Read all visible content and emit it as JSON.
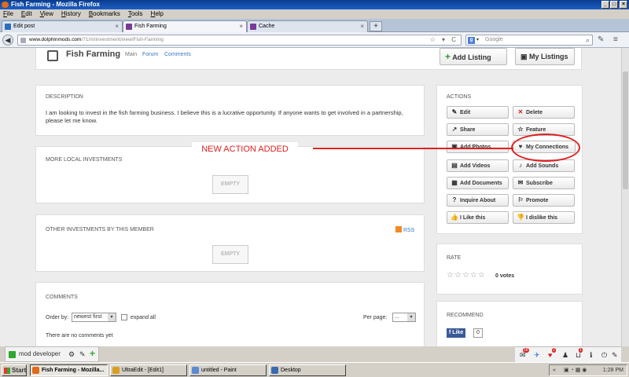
{
  "window": {
    "title": "Fish Farming - Mozilla Firefox",
    "minimize": "_",
    "maximize": "□",
    "close": "×"
  },
  "menu": [
    "File",
    "Edit",
    "View",
    "History",
    "Bookmarks",
    "Tools",
    "Help"
  ],
  "tabs": [
    {
      "label": "Edit post",
      "close": "×"
    },
    {
      "label": "Fish Farming",
      "close": "×"
    },
    {
      "label": "Cache",
      "close": "×"
    }
  ],
  "new_tab": "+",
  "nav": {
    "back": "◀",
    "url_domain": "www.dolphinmods.com",
    "url_path": "/71/m/investment/view/Fish-Farming",
    "url_controls": "☆ ▾ C",
    "search_engine_label": "g",
    "search_placeholder": "Google",
    "search_icon": "⌕",
    "wrench": "✎",
    "menu_icon": "≡"
  },
  "page": {
    "title": "Fish Farming",
    "subnav": [
      "Main",
      "Forum",
      "Comments"
    ],
    "add_listing": "Add Listing",
    "my_listings": "My Listings",
    "description": {
      "heading": "DESCRIPTION",
      "text": "I am looking to invest in the fish farming business. I believe this is a lucrative opportunity. If anyone wants to get involved in a partnership, please let me know."
    },
    "more_local": {
      "heading": "MORE LOCAL INVESTMENTS",
      "empty": "EMPTY"
    },
    "other_by_member": {
      "heading": "OTHER INVESTMENTS BY THIS MEMBER",
      "rss": "RSS",
      "empty": "EMPTY"
    },
    "comments": {
      "heading": "COMMENTS",
      "order_label": "Order by:",
      "order_value": "newest first",
      "expand_all": "expand all",
      "per_page_label": "Per page:",
      "per_page_value": "...",
      "none": "There are no comments yet"
    },
    "actions": {
      "heading": "ACTIONS",
      "buttons": [
        {
          "label": "Edit",
          "icon": "✎"
        },
        {
          "label": "Delete",
          "icon": "✕"
        },
        {
          "label": "Share",
          "icon": "↗"
        },
        {
          "label": "Feature",
          "icon": "☆"
        },
        {
          "label": "Add Photos",
          "icon": "▣"
        },
        {
          "label": "My Connections",
          "icon": "♥"
        },
        {
          "label": "Add Videos",
          "icon": "▤"
        },
        {
          "label": "Add Sounds",
          "icon": "♪"
        },
        {
          "label": "Add Documents",
          "icon": "▦"
        },
        {
          "label": "Subscribe",
          "icon": "✉"
        },
        {
          "label": "Inquire About",
          "icon": "?"
        },
        {
          "label": "Promote",
          "icon": "⚐"
        },
        {
          "label": "I Like this",
          "icon": "👍"
        },
        {
          "label": "I dislike this",
          "icon": "👎"
        }
      ]
    },
    "rate": {
      "heading": "RATE",
      "stars": "☆☆☆☆☆",
      "votes": "0 votes"
    },
    "recommend": {
      "heading": "RECOMMEND",
      "like": "Like",
      "count": "0"
    }
  },
  "annotation": {
    "text": "NEW ACTION ADDED"
  },
  "devbar": {
    "label": "mod developer",
    "gear": "⚙",
    "edit": "✎",
    "add": "+"
  },
  "rightbar": {
    "badges": [
      "18",
      "2",
      "1"
    ]
  },
  "taskbar": {
    "start": "Start",
    "items": [
      "Fish Farming - Mozilla...",
      "UltraEdit - [Edit1]",
      "untitled - Paint",
      "Desktop"
    ],
    "clock": "1:28 PM",
    "tray": "«"
  },
  "colors": {
    "annotation": "#e02020",
    "link": "#3a78c8",
    "facebook": "#3b5998",
    "devbar_green": "#2fa82f"
  }
}
